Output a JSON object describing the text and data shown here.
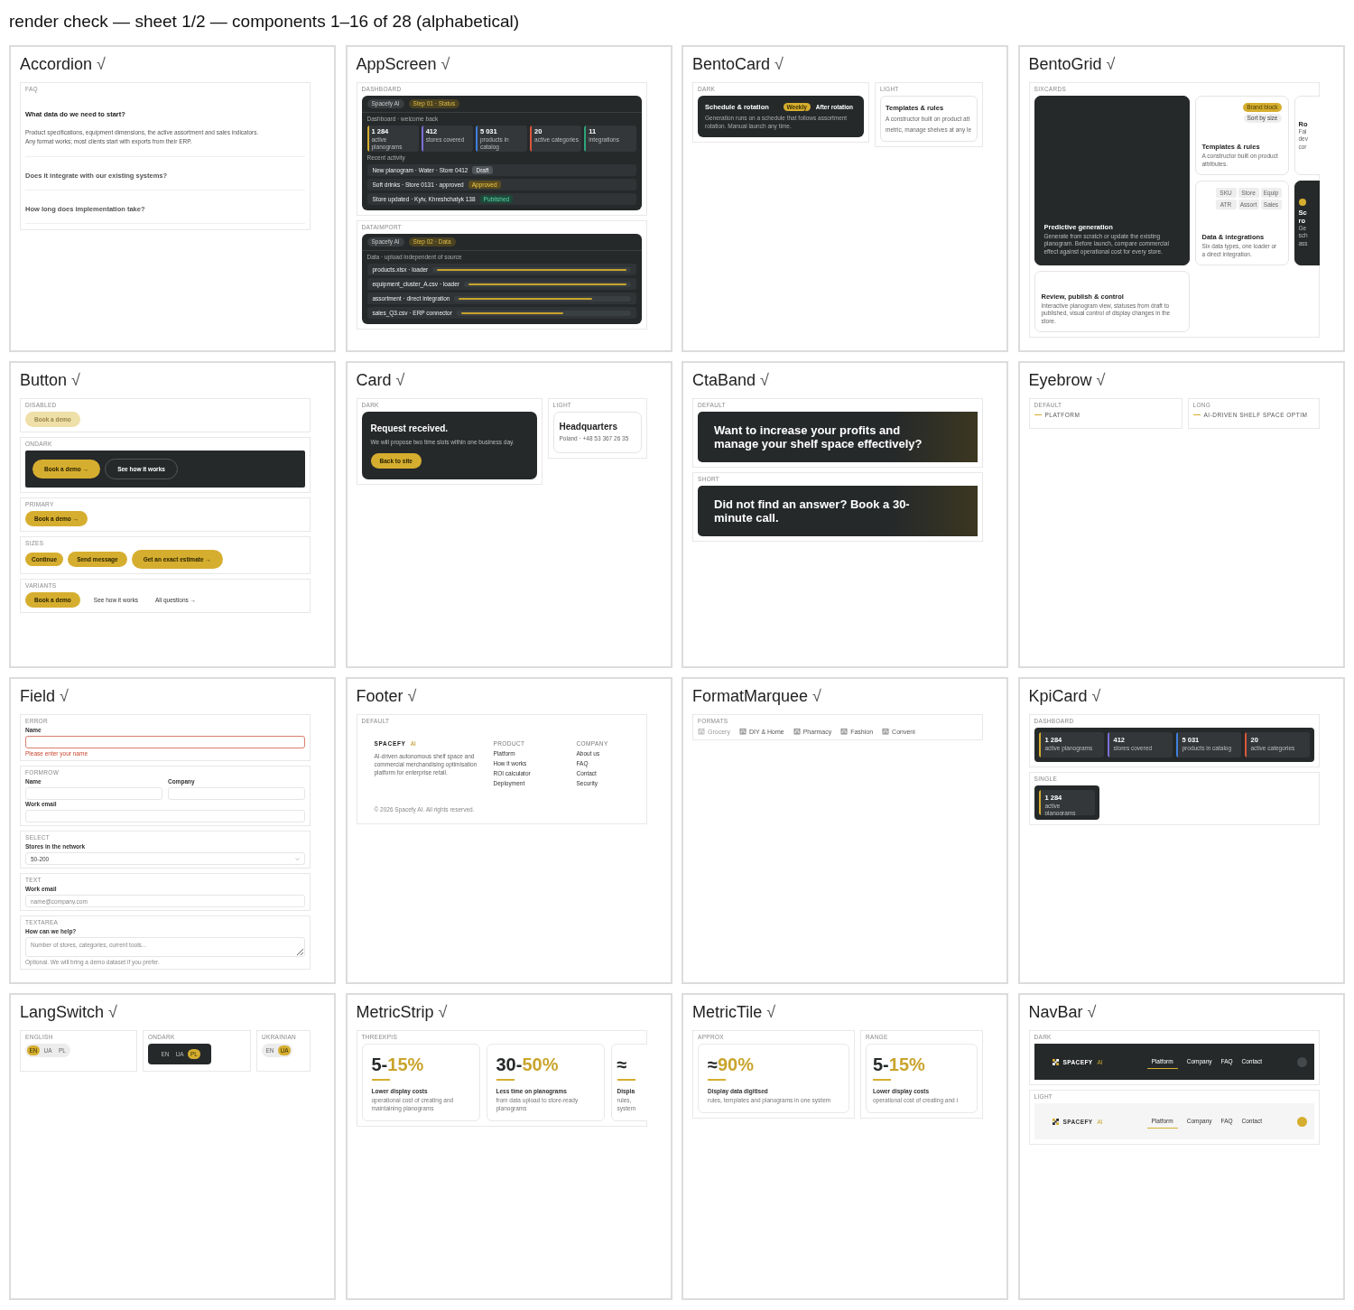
{
  "title": "render check — sheet 1/2 — components 1–16 of 28 (alphabetical)",
  "panels": [
    {
      "kind": "accordion",
      "name": "Accordion",
      "mark": "√",
      "sections": [
        {
          "label": "FAQ",
          "items": [
            {
              "question": "What data do we need to start?",
              "expanded": true,
              "answer_lines": [
                "Product specifications, equipment dimensions, the active assortment and sales indicators.",
                "Any format works; most clients start with exports from their ERP."
              ]
            },
            {
              "question": "Does it integrate with our existing systems?",
              "expanded": false
            },
            {
              "question": "How long does implementation take?",
              "expanded": false
            }
          ]
        }
      ]
    },
    {
      "kind": "appscreen",
      "name": "AppScreen",
      "mark": "√",
      "sections": [
        {
          "label": "DASHBOARD",
          "kind": "dashboard",
          "brand": "Spacefy AI",
          "step": "Step 01 · Status",
          "heading": "Dashboard · welcome back",
          "kpis": [
            {
              "value": "1 284",
              "label": "active planograms",
              "color": "#d6ae2f"
            },
            {
              "value": "412",
              "label": "stores covered",
              "color": "#7b6fd6"
            },
            {
              "value": "5 031",
              "label": "products in catalog",
              "color": "#3f7fe0"
            },
            {
              "value": "20",
              "label": "active categories",
              "color": "#d9573b"
            },
            {
              "value": "11",
              "label": "integrations",
              "color": "#2fa37a"
            }
          ],
          "activity_title": "Recent activity",
          "activity": [
            {
              "text": "New planogram · Water · Store 0412",
              "badge": "Draft",
              "kind": "draft"
            },
            {
              "text": "Soft drinks · Store 0131 · approved",
              "badge": "Approved",
              "kind": "approved"
            },
            {
              "text": "Store updated · Kyiv, Khreshchatyk 138",
              "badge": "Published",
              "kind": "published"
            }
          ]
        },
        {
          "label": "DATAIMPORT",
          "kind": "import",
          "brand": "Spacefy AI",
          "step": "Step 02 · Data",
          "heading": "Data · upload independent of source",
          "files": [
            {
              "name": "products.xlsx · loader",
              "level": 1
            },
            {
              "name": "equipment_cluster_A.csv · loader",
              "level": 1
            },
            {
              "name": "assortment · direct integration",
              "level": 0.8
            },
            {
              "name": "sales_Q3.csv · ERP connector",
              "level": 0.62
            }
          ]
        }
      ]
    },
    {
      "kind": "bentocard",
      "name": "BentoCard",
      "mark": "√",
      "sections": [
        {
          "label": "DARK",
          "kind": "dark",
          "title": "Schedule & rotation",
          "pills": [
            {
              "label": "Weekly",
              "selected": true
            },
            {
              "label": "After rotation",
              "selected": false
            }
          ],
          "text": "Generation runs on a schedule that follows assortment rotation. Manual launch any time."
        },
        {
          "label": "LIGHT",
          "kind": "light",
          "title": "Templates & rules",
          "lines": [
            "A constructor built on product att",
            "metric, manage shelves at any le"
          ]
        }
      ]
    },
    {
      "kind": "bentogrid",
      "name": "BentoGrid",
      "mark": "√",
      "sections": [
        {
          "label": "SIXCARDS",
          "cards": [
            {
              "kind": "hero",
              "title": "Predictive generation",
              "text": "Generate from scratch or update the existing planogram. Before launch, compare commercial effect against operational cost for every store."
            },
            {
              "kind": "chips",
              "title": "Templates & rules",
              "chips": [
                {
                  "label": "Brand block",
                  "selected": true
                },
                {
                  "label": "Sort by size",
                  "selected": false
                }
              ],
              "text": "A constructor built on product attributes."
            },
            {
              "kind": "cut",
              "title": "Ro",
              "lines": [
                "Fal",
                "dev",
                "cor"
              ]
            },
            {
              "kind": "tiles",
              "title": "Data & integrations",
              "tiles": [
                "SKU",
                "Store",
                "Equip",
                "ATR",
                "Assort",
                "Sales"
              ],
              "text": "Six data types, one loader or a direct integration."
            },
            {
              "kind": "cut_dark",
              "title_lines": [
                "Sc",
                "ro"
              ],
              "lines": [
                "Ge",
                "sch",
                "ass"
              ]
            },
            {
              "kind": "wide",
              "title": "Review, publish & control",
              "text": "Interactive planogram view, statuses from draft to published, visual control of display changes in the store."
            }
          ]
        }
      ]
    },
    {
      "kind": "button",
      "name": "Button",
      "mark": "√",
      "sections": [
        {
          "label": "DISABLED",
          "dark": false,
          "buttons": [
            {
              "label": "Book a demo",
              "kind": "primary",
              "disabled": true
            }
          ]
        },
        {
          "label": "ONDARK",
          "dark": true,
          "buttons": [
            {
              "label": "Book a demo →",
              "kind": "large",
              "disabled": false
            },
            {
              "label": "See how it works",
              "kind": "outline",
              "disabled": false
            }
          ]
        },
        {
          "label": "PRIMARY",
          "dark": false,
          "buttons": [
            {
              "label": "Book a demo →",
              "kind": "primary",
              "disabled": false
            }
          ]
        },
        {
          "label": "SIZES",
          "dark": false,
          "buttons": [
            {
              "label": "Continue",
              "kind": "small",
              "disabled": false
            },
            {
              "label": "Send message",
              "kind": "primary",
              "disabled": false
            },
            {
              "label": "Get an exact estimate →",
              "kind": "large",
              "disabled": false
            }
          ]
        },
        {
          "label": "VARIANTS",
          "dark": false,
          "buttons": [
            {
              "label": "Book a demo",
              "kind": "primary",
              "disabled": false
            },
            {
              "label": "See how it works",
              "kind": "ghost",
              "disabled": false
            },
            {
              "label": "All questions →",
              "kind": "link",
              "disabled": false
            }
          ]
        }
      ]
    },
    {
      "kind": "card",
      "name": "Card",
      "mark": "√",
      "sections": [
        {
          "label": "DARK",
          "kind": "dark",
          "title": "Request received.",
          "text": "We will propose two time slots within one business day.",
          "button": "Back to site"
        },
        {
          "label": "LIGHT",
          "kind": "light",
          "title": "Headquarters",
          "text": "Poland · +48 53 367 26 35"
        }
      ]
    },
    {
      "kind": "ctaband",
      "name": "CtaBand",
      "mark": "√",
      "sections": [
        {
          "label": "DEFAULT",
          "text": "Want to increase your profits and manage your shelf space effectively?"
        },
        {
          "label": "SHORT",
          "text": "Did not find an answer? Book a 30-minute call."
        }
      ]
    },
    {
      "kind": "eyebrow",
      "name": "Eyebrow",
      "mark": "√",
      "sections": [
        {
          "label": "DEFAULT",
          "text": "PLATFORM"
        },
        {
          "label": "LONG",
          "text": "AI-DRIVEN SHELF SPACE OPTIM"
        }
      ]
    },
    {
      "kind": "field",
      "name": "Field",
      "mark": "√",
      "sections": [
        {
          "label": "ERROR",
          "rows": [
            [
              {
                "label": "Name",
                "kind": "input",
                "invalid": true,
                "error": "Please enter your name"
              }
            ]
          ]
        },
        {
          "label": "FORMROW",
          "rows": [
            [
              {
                "label": "Name",
                "kind": "input",
                "invalid": false
              },
              {
                "label": "Company",
                "kind": "input",
                "invalid": false
              }
            ],
            [
              {
                "label": "Work email",
                "kind": "input",
                "invalid": false
              }
            ]
          ]
        },
        {
          "label": "SELECT",
          "rows": [
            [
              {
                "label": "Stores in the network",
                "kind": "select",
                "value": "50-200",
                "invalid": false
              }
            ]
          ]
        },
        {
          "label": "TEXT",
          "rows": [
            [
              {
                "label": "Work email",
                "kind": "input",
                "placeholder": "name@company.com",
                "invalid": false
              }
            ]
          ]
        },
        {
          "label": "TEXTAREA",
          "rows": [
            [
              {
                "label": "How can we help?",
                "kind": "textarea",
                "placeholder": "Number of stores, categories, current tools...",
                "hint": "Optional. We will bring a demo dataset if you prefer.",
                "invalid": false
              }
            ]
          ]
        }
      ]
    },
    {
      "kind": "footer",
      "name": "Footer",
      "mark": "√",
      "sections": [
        {
          "label": "DEFAULT",
          "brand": "SPACEFY",
          "tag": "AI",
          "text": "AI-driven autonomous shelf space and commercial merchandising optimisation platform for enterprise retail.",
          "columns": [
            {
              "heading": "PRODUCT",
              "links": [
                "Platform",
                "How it works",
                "ROI calculator",
                "Deployment"
              ]
            },
            {
              "heading": "COMPANY",
              "links": [
                "About us",
                "FAQ",
                "Contact",
                "Security"
              ]
            }
          ],
          "copyright": "© 2026 Spacefy AI. All rights reserved."
        }
      ]
    },
    {
      "kind": "marquee",
      "name": "FormatMarquee",
      "mark": "√",
      "sections": [
        {
          "label": "FORMATS",
          "items": [
            {
              "label": "Grocery",
              "faded": true
            },
            {
              "label": "DIY & Home",
              "faded": false
            },
            {
              "label": "Pharmacy",
              "faded": false
            },
            {
              "label": "Fashion",
              "faded": false
            },
            {
              "label": "Conveni",
              "faded": false
            }
          ]
        }
      ]
    },
    {
      "kind": "kpicard",
      "name": "KpiCard",
      "mark": "√",
      "sections": [
        {
          "label": "DASHBOARD",
          "kpis": [
            {
              "value": "1 284",
              "label": "active planograms",
              "color": "#d6ae2f"
            },
            {
              "value": "412",
              "label": "stores covered",
              "color": "#7b6fd6"
            },
            {
              "value": "5 031",
              "label": "products in catalog",
              "color": "#3f7fe0"
            },
            {
              "value": "20",
              "label": "active categories",
              "color": "#d9573b"
            }
          ]
        },
        {
          "label": "SINGLE",
          "kpis": [
            {
              "value": "1 284",
              "label": "active planograms",
              "color": "#d6ae2f"
            }
          ]
        }
      ]
    },
    {
      "kind": "langswitch",
      "name": "LangSwitch",
      "mark": "√",
      "sections": [
        {
          "label": "ENGLISH",
          "dark": false,
          "options": [
            {
              "label": "EN",
              "selected": true
            },
            {
              "label": "UA",
              "selected": false
            },
            {
              "label": "PL",
              "selected": false
            }
          ]
        },
        {
          "label": "ONDARK",
          "dark": true,
          "options": [
            {
              "label": "EN",
              "selected": false
            },
            {
              "label": "UA",
              "selected": false
            },
            {
              "label": "PL",
              "selected": true
            }
          ]
        },
        {
          "label": "UKRAINIAN",
          "dark": false,
          "options": [
            {
              "label": "EN",
              "selected": false
            },
            {
              "label": "UA",
              "selected": true
            }
          ]
        }
      ]
    },
    {
      "kind": "metricstrip",
      "name": "MetricStrip",
      "mark": "√",
      "sections": [
        {
          "label": "THREEKPIS",
          "metrics": [
            {
              "prefix": "5-",
              "value": "15%",
              "title": "Lower display costs",
              "lines": [
                "operational cost of creating and",
                "maintaining planograms"
              ]
            },
            {
              "prefix": "30-",
              "value": "50%",
              "title": "Less time on planograms",
              "lines": [
                "from data upload to store-ready",
                "planograms"
              ]
            },
            {
              "prefix": "≈",
              "title": "Displa",
              "lines": [
                "rules,",
                "system"
              ]
            }
          ]
        }
      ]
    },
    {
      "kind": "metrictile",
      "name": "MetricTile",
      "mark": "√",
      "sections": [
        {
          "label": "APPROX",
          "prefix": "≈",
          "value": "90%",
          "title": "Display data digitised",
          "lines": [
            "rules, templates and planograms in one system"
          ]
        },
        {
          "label": "RANGE",
          "prefix": "5-",
          "value": "15%",
          "title": "Lower display costs",
          "lines": [
            "operational cost of creating and i"
          ]
        }
      ]
    },
    {
      "kind": "navbar",
      "name": "NavBar",
      "mark": "√",
      "sections": [
        {
          "label": "DARK",
          "dark": true,
          "brand": "SPACEFY",
          "tag": "AI",
          "links": [
            {
              "label": "Platform",
              "selected": true
            },
            {
              "label": "Company",
              "selected": false
            },
            {
              "label": "FAQ",
              "selected": false
            },
            {
              "label": "Contact",
              "selected": false
            }
          ]
        },
        {
          "label": "LIGHT",
          "dark": false,
          "brand": "SPACEFY",
          "tag": "AI",
          "links": [
            {
              "label": "Platform",
              "selected": true
            },
            {
              "label": "Company",
              "selected": false
            },
            {
              "label": "FAQ",
              "selected": false
            },
            {
              "label": "Contact",
              "selected": false
            }
          ]
        }
      ]
    }
  ]
}
